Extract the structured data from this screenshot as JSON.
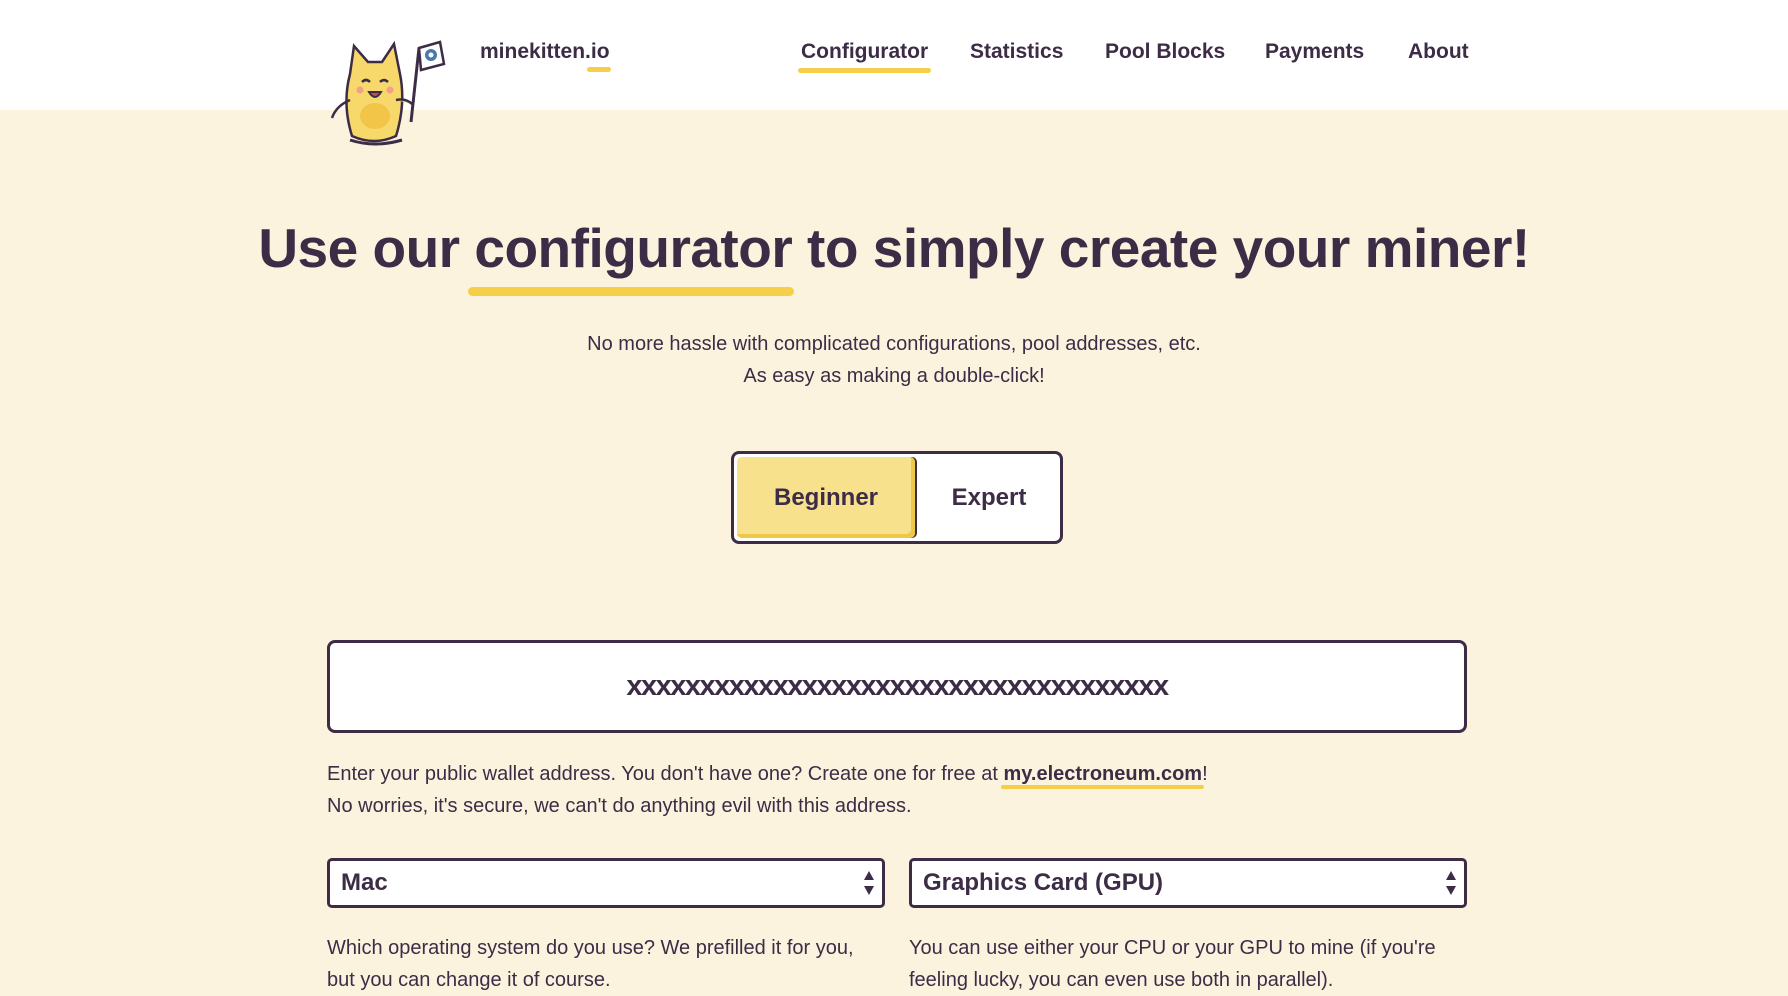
{
  "header": {
    "brand": "minekitten.io",
    "nav": [
      {
        "label": "Configurator",
        "active": true
      },
      {
        "label": "Statistics",
        "active": false
      },
      {
        "label": "Pool Blocks",
        "active": false
      },
      {
        "label": "Payments",
        "active": false
      },
      {
        "label": "About",
        "active": false
      }
    ]
  },
  "hero": {
    "title_pre": "Use our ",
    "title_highlight": "configurator",
    "title_post": " to simply create your miner!",
    "subtitle_line1": "No more hassle with complicated configurations, pool addresses, etc.",
    "subtitle_line2": "As easy as making a double-click!"
  },
  "mode_toggle": {
    "options": [
      "Beginner",
      "Expert"
    ],
    "selected": "Beginner"
  },
  "wallet": {
    "value": "xxxxxxxxxxxxxxxxxxxxxxxxxxxxxxxxxxxxx",
    "help_pre": "Enter your public wallet address. You don't have one? Create one for free at ",
    "help_link": "my.electroneum.com",
    "help_post": "!",
    "help_line2": "No worries, it's secure, we can't do anything evil with this address."
  },
  "os_select": {
    "value": "Mac",
    "help_line1": "Which operating system do you use? We prefilled it for you,",
    "help_line2": "but you can change it of course."
  },
  "device_select": {
    "value": "Graphics Card (GPU)",
    "help_line1": "You can use either your CPU or your GPU to mine (if you're",
    "help_line2": "feeling lucky, you can even use both in parallel)."
  },
  "colors": {
    "background": "#fcf3df",
    "header": "#ffffff",
    "text": "#3d2c46",
    "accent": "#f5cf49",
    "beginner_fill": "#f7e18c"
  },
  "icons": {
    "mascot": "kitten-with-flag-logo",
    "select_arrows": "updown-arrows-icon"
  }
}
